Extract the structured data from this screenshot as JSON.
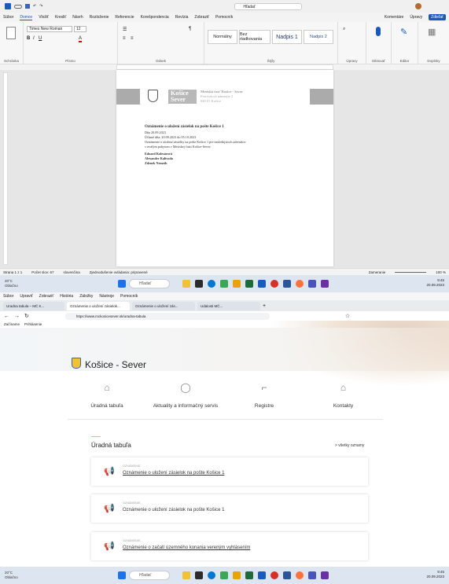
{
  "word": {
    "ribbon_tabs": [
      "Súbor",
      "Domov",
      "Vložiť",
      "Kresliť",
      "Návrh",
      "Rozloženie",
      "Referencie",
      "Korešpondencia",
      "Revízia",
      "Zobraziť",
      "Pomocník"
    ],
    "font_name": "Times New Roman",
    "font_size": "12",
    "styles": [
      "Normálny",
      "Bez riadkovania",
      "Nadpis 1",
      "Nadpis 2"
    ],
    "group_labels": [
      "Schránka",
      "Písmo",
      "Odsek",
      "Štýly",
      "Úpravy",
      "Diktovať",
      "Editor",
      "Doplnky"
    ],
    "search_placeholder": "Hľadať",
    "comments_label": "Komentáre",
    "editing_label": "Úpravy",
    "share_label": "Zdieľať",
    "letterhead": {
      "logo_lines": [
        "Košice",
        "Sever"
      ],
      "org": "Mestská časť Košice - Sever",
      "street": "Festivalové námestie 2",
      "city": "040 01 Košice"
    },
    "body": {
      "title": "Oznámenie o uložení zásielok na pošte Košice 1",
      "issued": "Dňa 20.09.2023",
      "validity": "Účinné dňa: 20.09.2023 do 05.10.2023",
      "line1": "Oznámenie o uložení zásielky na pošte Košice 1 pre nasledujúcich adresátov",
      "line2": "s trvalým pobytom v Mestskej časti Košice-Sever:",
      "names": [
        "Eduard Kolesárová",
        "Alexander Kalivoda",
        "Zdenek Nemeth"
      ]
    },
    "status": {
      "page": "Strana 1 z 1",
      "words": "Počet slov: 67",
      "lang": "slovenčina",
      "access": "Zjednodušenie ovládania: pripravené",
      "focus": "Zameranie",
      "zoom": "100 %"
    }
  },
  "taskbar": {
    "weather_temp": "20°C",
    "weather_text": "Oblačno",
    "search": "Hľadať",
    "time": "9:45",
    "date": "20.09.2023"
  },
  "browser": {
    "menu": [
      "Súbor",
      "Upraviť",
      "Zobraziť",
      "História",
      "Záložky",
      "Nástroje",
      "Pomocník"
    ],
    "tabs": [
      "Uradna tabula – MČ K...",
      "Oznámenie o uložení zásielok...",
      "Oznámenie o uložení zás...",
      "Udalosti MČ..."
    ],
    "url": "https://www.mckosicesever.sk/uradna-tabula",
    "bookmarks": [
      "Začíname",
      "Prihlásenie"
    ],
    "site_title": "Košice - Sever",
    "nav": [
      "Úradná tabuľa",
      "Aktuality a informačný servis",
      "Registre",
      "Kontakty"
    ],
    "board_title": "Úradná tabuľa",
    "board_all": "> všetky oznamy",
    "cards": [
      {
        "category": "OZNÁMENIE",
        "title": "Oznámenie o uložení zásielok na pošte Košice 1"
      },
      {
        "category": "OZNÁMENIE",
        "title": "Oznámenie o uložení zásielok na pošte Košice 1"
      },
      {
        "category": "OZNÁMENIE",
        "title": "Oznámenie o začatí územného konania vereným vyhlásením"
      }
    ]
  }
}
